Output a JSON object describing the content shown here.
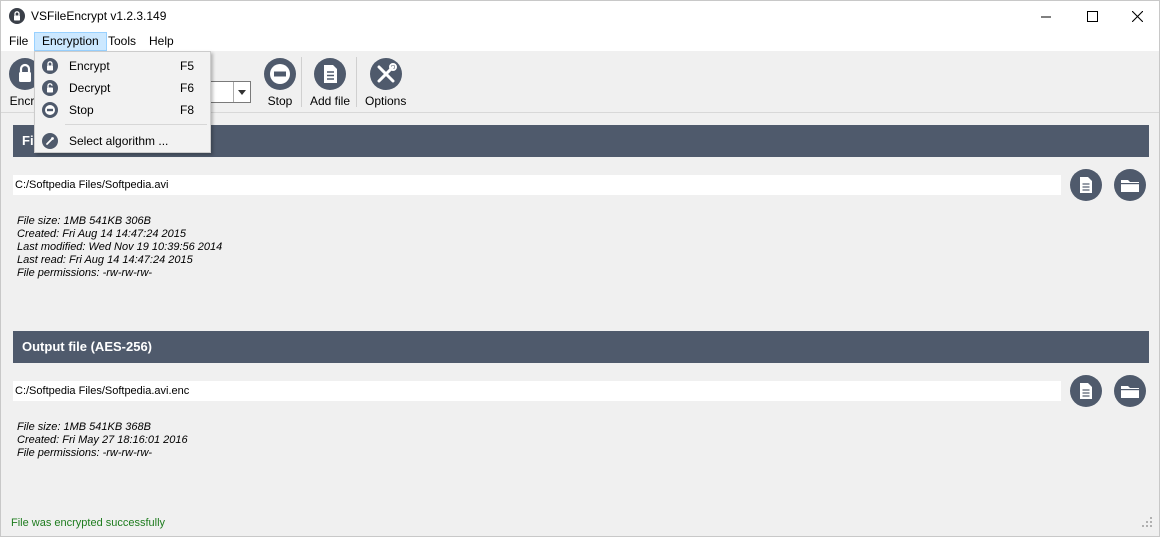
{
  "window": {
    "title": "VSFileEncrypt v1.2.3.149"
  },
  "menubar": {
    "items": [
      "File",
      "Encryption",
      "Tools",
      "Help"
    ]
  },
  "toolbar": {
    "encrypt_label": "Encry",
    "stop_label": "Stop",
    "add_file_label": "Add file",
    "options_label": "Options"
  },
  "encryption_menu": {
    "items": [
      {
        "label": "Encrypt",
        "shortcut": "F5",
        "icon": "lock-icon"
      },
      {
        "label": "Decrypt",
        "shortcut": "F6",
        "icon": "unlock-icon"
      },
      {
        "label": "Stop",
        "shortcut": "F8",
        "icon": "stop-icon"
      },
      {
        "label": "Select algorithm ...",
        "shortcut": "",
        "icon": "key-icon"
      }
    ]
  },
  "input_section": {
    "header": "Fi",
    "path": "C:/Softpedia Files/Softpedia.avi",
    "info": [
      "File size: 1MB 541KB 306B",
      "Created: Fri Aug 14 14:47:24 2015",
      "Last modified: Wed Nov 19 10:39:56 2014",
      "Last read: Fri Aug 14 14:47:24 2015",
      "File permissions: -rw-rw-rw-"
    ]
  },
  "output_section": {
    "header": "Output file (AES-256)",
    "path": "C:/Softpedia Files/Softpedia.avi.enc",
    "info": [
      "File size: 1MB 541KB 368B",
      "Created: Fri May 27 18:16:01 2016",
      "File permissions: -rw-rw-rw-"
    ]
  },
  "status": {
    "text": "File was encrypted successfully"
  },
  "colors": {
    "header_bg": "#4f5a6c",
    "status_text": "#1e7c1e",
    "menu_highlight": "#cce8ff"
  }
}
